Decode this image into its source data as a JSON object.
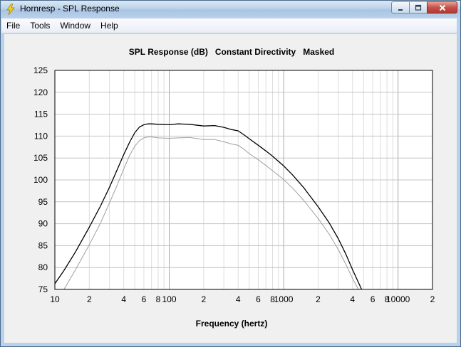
{
  "window": {
    "title": "Hornresp - SPL Response"
  },
  "menu": {
    "items": [
      {
        "id": "file",
        "label": "File"
      },
      {
        "id": "tools",
        "label": "Tools"
      },
      {
        "id": "window",
        "label": "Window"
      },
      {
        "id": "help",
        "label": "Help"
      }
    ]
  },
  "chart_data": {
    "type": "line",
    "title": "SPL Response (dB)   Constant Directivity   Masked",
    "xlabel": "Frequency (hertz)",
    "ylabel": "",
    "xscale": "log",
    "xlim": [
      10,
      20000
    ],
    "ylim": [
      75,
      125
    ],
    "yticks": [
      75,
      80,
      85,
      90,
      95,
      100,
      105,
      110,
      115,
      120,
      125
    ],
    "xtick_labels": [
      {
        "x": 10,
        "label": "10"
      },
      {
        "x": 20,
        "label": "2"
      },
      {
        "x": 40,
        "label": "4"
      },
      {
        "x": 60,
        "label": "6"
      },
      {
        "x": 80,
        "label": "8"
      },
      {
        "x": 100,
        "label": "100"
      },
      {
        "x": 200,
        "label": "2"
      },
      {
        "x": 400,
        "label": "4"
      },
      {
        "x": 600,
        "label": "6"
      },
      {
        "x": 800,
        "label": "8"
      },
      {
        "x": 1000,
        "label": "1000"
      },
      {
        "x": 2000,
        "label": "2"
      },
      {
        "x": 4000,
        "label": "4"
      },
      {
        "x": 6000,
        "label": "6"
      },
      {
        "x": 8000,
        "label": "8"
      },
      {
        "x": 10000,
        "label": "10000"
      },
      {
        "x": 20000,
        "label": "2"
      }
    ],
    "grid": true,
    "series": [
      {
        "color": "#000000",
        "x": [
          10,
          12,
          15,
          20,
          25,
          30,
          35,
          40,
          45,
          50,
          55,
          60,
          65,
          70,
          80,
          100,
          120,
          150,
          200,
          250,
          300,
          350,
          400,
          450,
          500,
          600,
          700,
          800,
          1000,
          1200,
          1500,
          2000,
          2500,
          3000,
          3500,
          4000,
          4500,
          4800
        ],
        "y": [
          76.3,
          79.3,
          83.4,
          89.2,
          94.0,
          98.3,
          102.3,
          105.8,
          108.6,
          110.8,
          112.1,
          112.6,
          112.8,
          112.8,
          112.7,
          112.6,
          112.8,
          112.7,
          112.3,
          112.4,
          112.0,
          111.5,
          111.2,
          110.3,
          109.4,
          107.9,
          106.6,
          105.4,
          103.2,
          101.1,
          98.2,
          93.9,
          90.2,
          86.6,
          83.0,
          79.5,
          76.6,
          75.0
        ]
      },
      {
        "color": "#a0a0a0",
        "x": [
          12,
          15,
          20,
          25,
          30,
          35,
          40,
          45,
          50,
          55,
          60,
          65,
          70,
          80,
          100,
          120,
          150,
          200,
          250,
          300,
          350,
          400,
          450,
          500,
          600,
          700,
          800,
          1000,
          1200,
          1500,
          2000,
          2500,
          3000,
          3500,
          4000,
          4500
        ],
        "y": [
          75.0,
          79.3,
          85.2,
          90.1,
          94.7,
          98.8,
          102.5,
          105.6,
          107.7,
          109.0,
          109.6,
          109.8,
          109.8,
          109.6,
          109.5,
          109.6,
          109.7,
          109.2,
          109.2,
          108.7,
          108.2,
          107.9,
          107.0,
          106.0,
          104.6,
          103.3,
          102.1,
          100.1,
          98.1,
          95.3,
          91.2,
          87.6,
          84.1,
          80.7,
          77.5,
          75.0
        ]
      }
    ]
  }
}
